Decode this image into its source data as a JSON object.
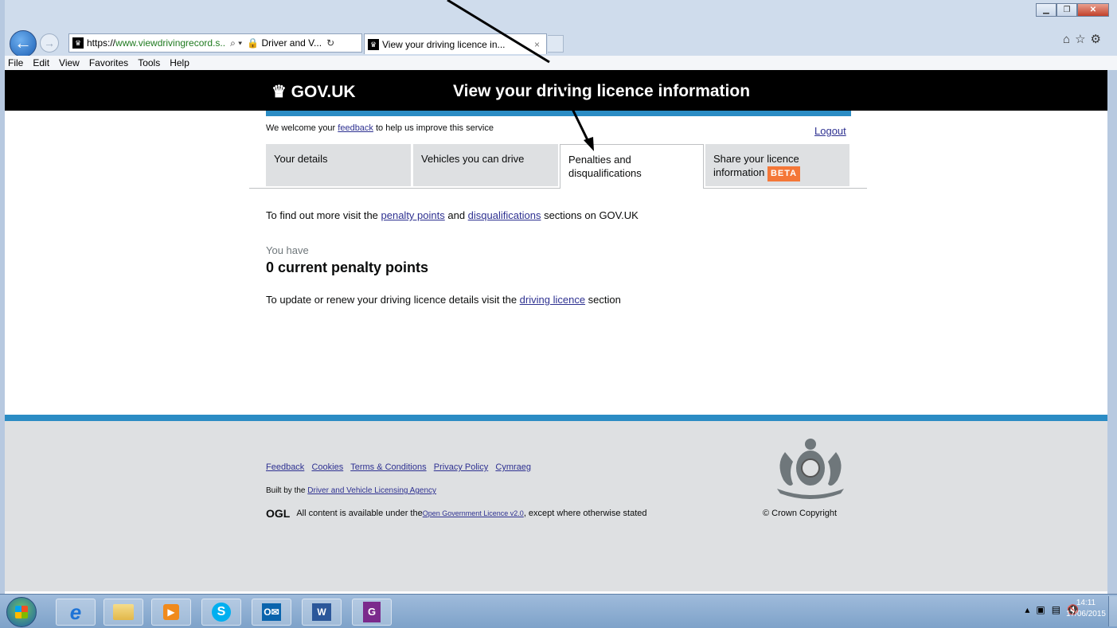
{
  "browser": {
    "url_https": "https://",
    "url_rest": "www.viewdrivingrecord.s..",
    "address_search": "⌕ ▾",
    "address_site": "🔒 Driver and V...",
    "address_refresh": "↻",
    "tab_title": "View your driving licence in...",
    "menu": [
      "File",
      "Edit",
      "View",
      "Favorites",
      "Tools",
      "Help"
    ]
  },
  "header": {
    "logo": "GOV.UK",
    "service": "View your driving licence information"
  },
  "feedback": {
    "prefix": "We welcome your ",
    "link": "feedback",
    "suffix": " to help us improve this service"
  },
  "logout": "Logout",
  "tabs": {
    "t1": "Your details",
    "t2": "Vehicles you can drive",
    "t3": "Penalties and disqualifications",
    "t4_prefix": "Share your licence information",
    "t4_badge": "BETA"
  },
  "content": {
    "find_prefix": "To find out more visit the ",
    "penalty_link": "penalty points",
    "find_and": " and ",
    "disq_link": "disqualifications",
    "find_suffix": " sections on GOV.UK",
    "you_have": "You have",
    "points": "0 current penalty points",
    "update_prefix": "To update or renew your driving licence details visit the ",
    "licence_link": "driving licence",
    "update_suffix": " section"
  },
  "footer": {
    "links": [
      "Feedback",
      "Cookies",
      "Terms & Conditions",
      "Privacy Policy",
      "Cymraeg"
    ],
    "built_prefix": "Built by the ",
    "built_link": "Driver and Vehicle Licensing Agency",
    "ogl_logo": "OGL",
    "ogl_prefix": "All content is available under the ",
    "ogl_link": "Open Government Licence v2.0",
    "ogl_suffix": ", except where otherwise stated",
    "copyright": "© Crown Copyright"
  },
  "taskbar": {
    "time": "14:11",
    "date": "17/06/2015"
  },
  "colors": {
    "govuk_blue": "#2b8cc4",
    "beta_orange": "#f47738",
    "link": "#2e3191"
  }
}
